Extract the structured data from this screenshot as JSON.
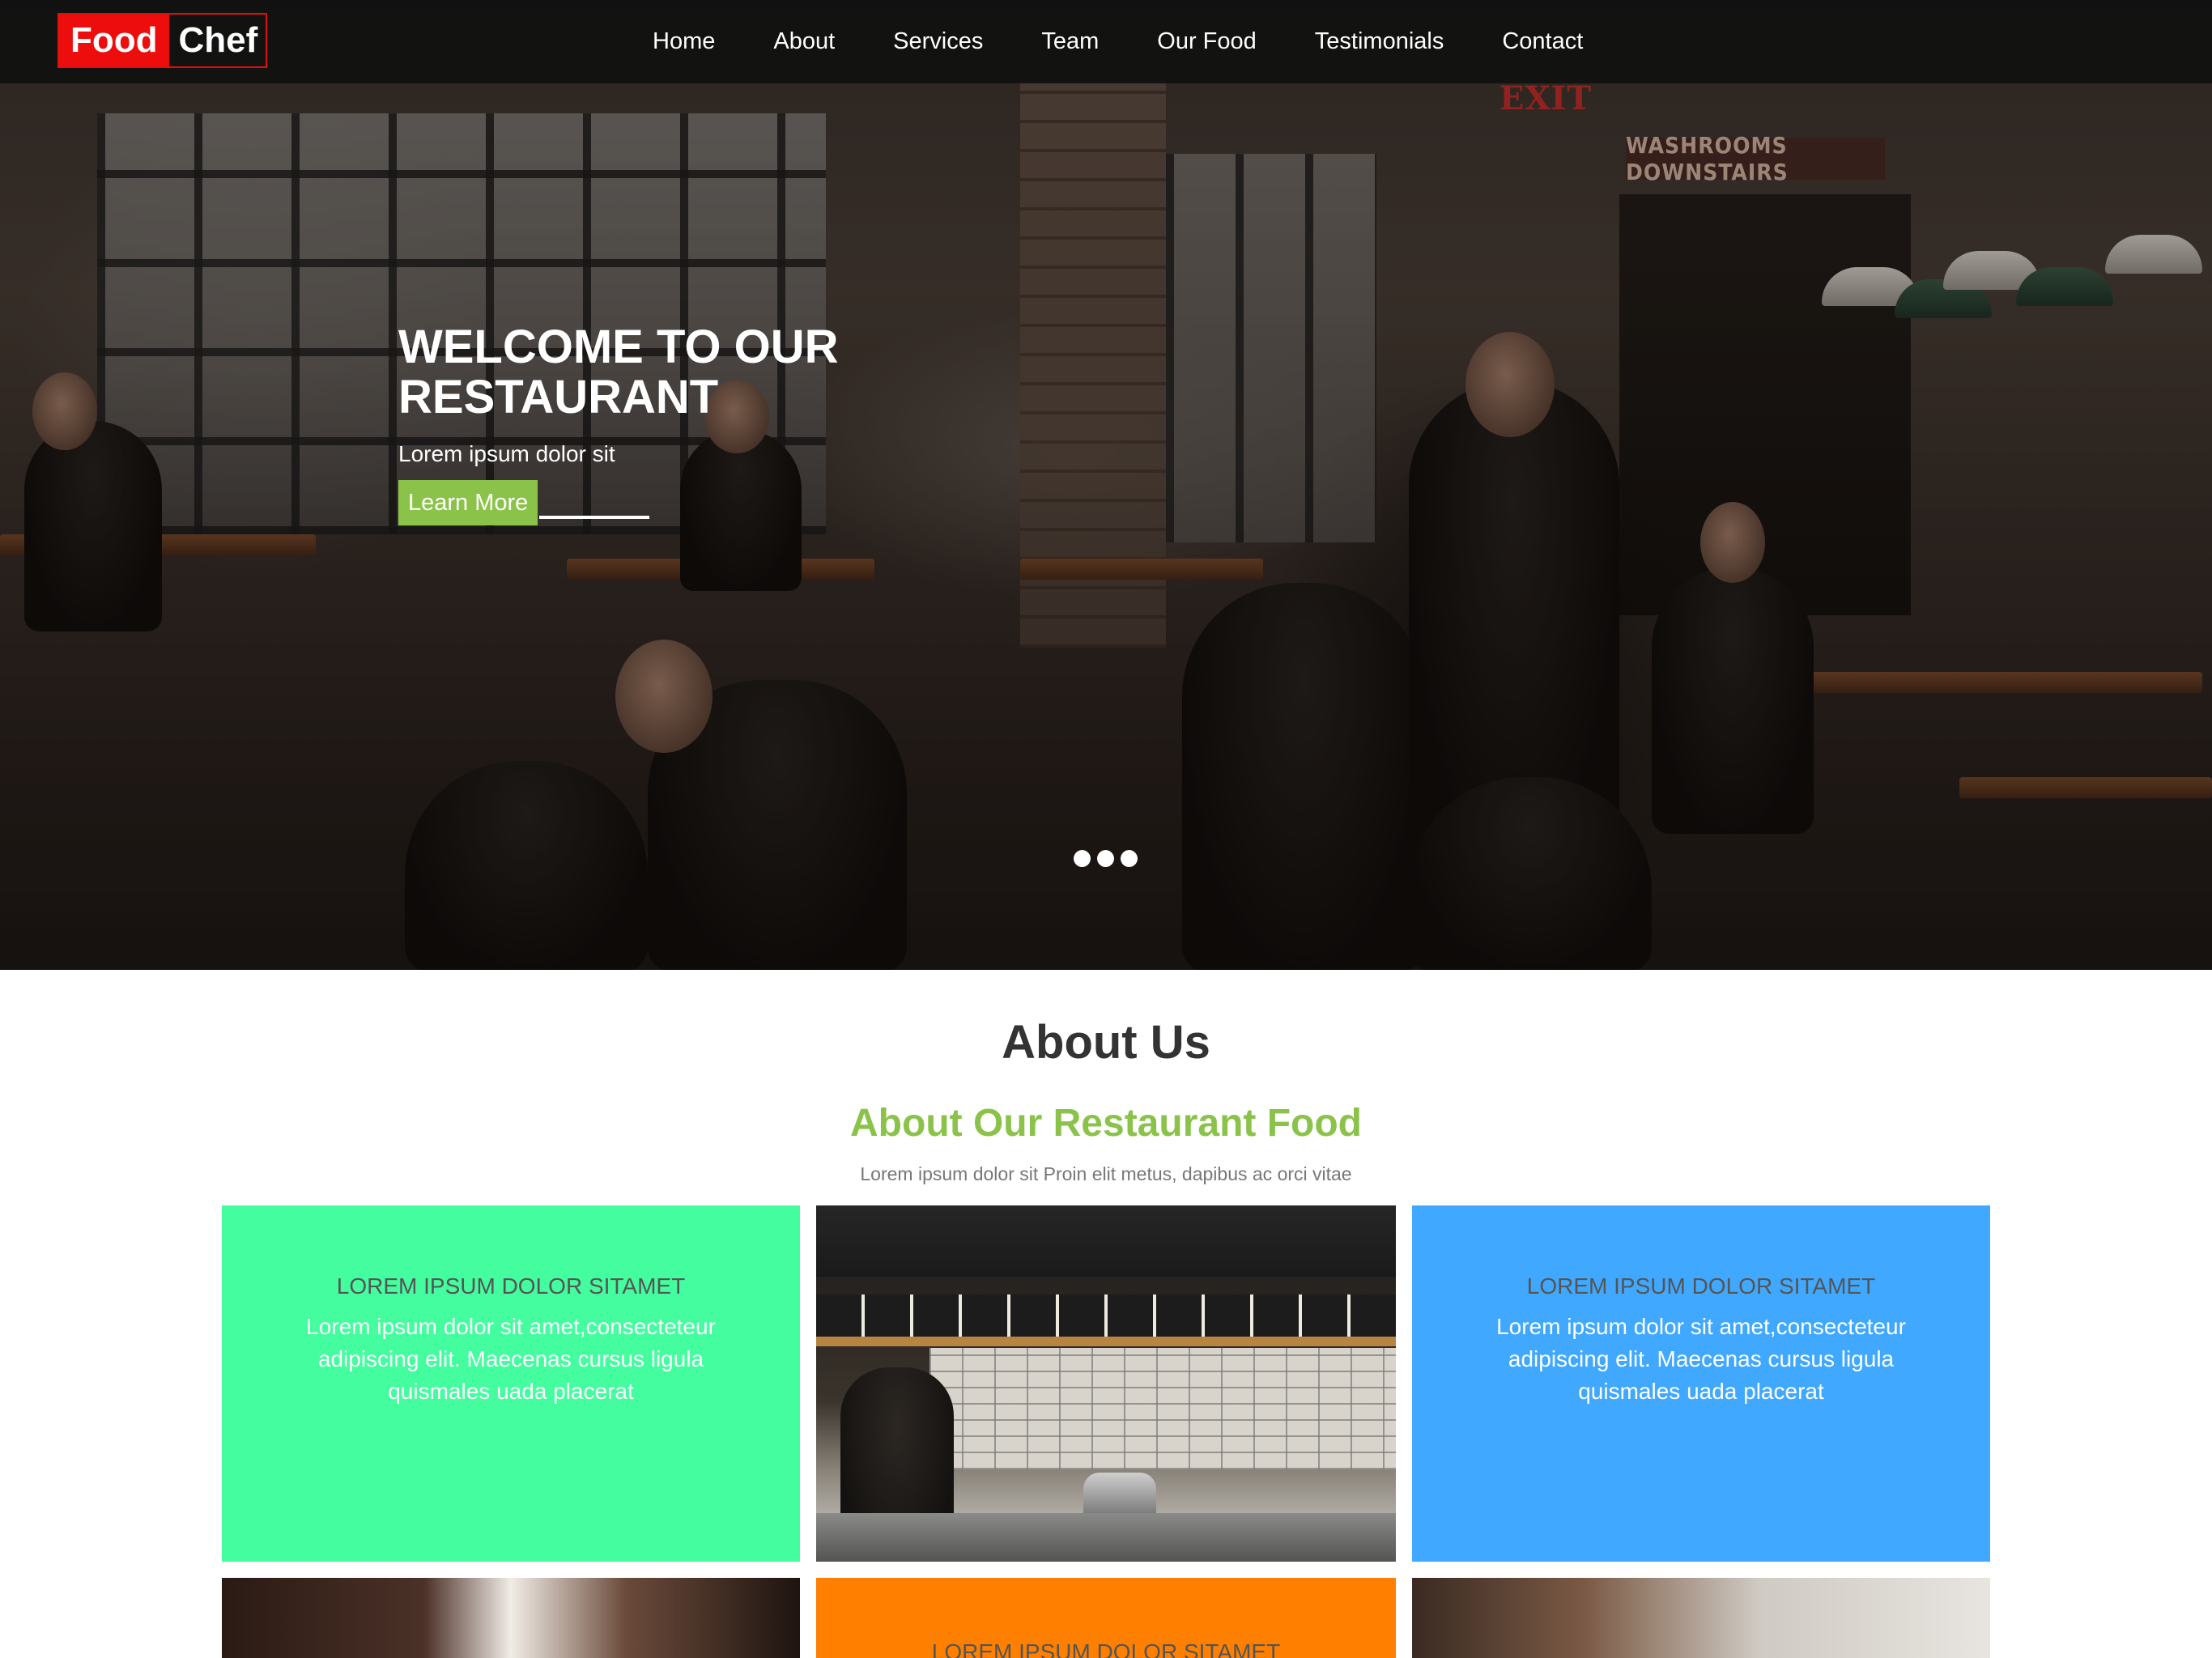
{
  "brand": {
    "part1": "Food",
    "part2": "Chef"
  },
  "nav": {
    "items": [
      "Home",
      "About",
      "Services",
      "Team",
      "Our Food",
      "Testimonials",
      "Contact"
    ]
  },
  "hero": {
    "title": "WELCOME TO OUR RESTAURANT",
    "subtitle": "Lorem ipsum dolor sit",
    "button_label": "Learn More",
    "slide_count": 3
  },
  "about": {
    "title": "About Us",
    "subtitle": "About Our Restaurant Food",
    "description": "Lorem ipsum dolor sit Proin elit metus, dapibus ac orci vitae",
    "cards": [
      {
        "heading": "LOREM IPSUM DOLOR SITAMET",
        "text": "Lorem ipsum dolor sit amet,consecteteur adipiscing elit. Maecenas cursus ligula quismales uada placerat",
        "color": "#44fd9e"
      },
      {
        "heading": "LOREM IPSUM DOLOR SITAMET",
        "text": "Lorem ipsum dolor sit amet,consecteteur adipiscing elit. Maecenas cursus ligula quismales uada placerat",
        "color": "#40a8ff"
      },
      {
        "heading": "LOREM IPSUM DOLOR SITAMET",
        "color": "#ff7f00"
      }
    ]
  },
  "colors": {
    "accent_green": "#8bc34a",
    "brand_red": "#ee0d0d",
    "nav_bg": "#101010"
  }
}
